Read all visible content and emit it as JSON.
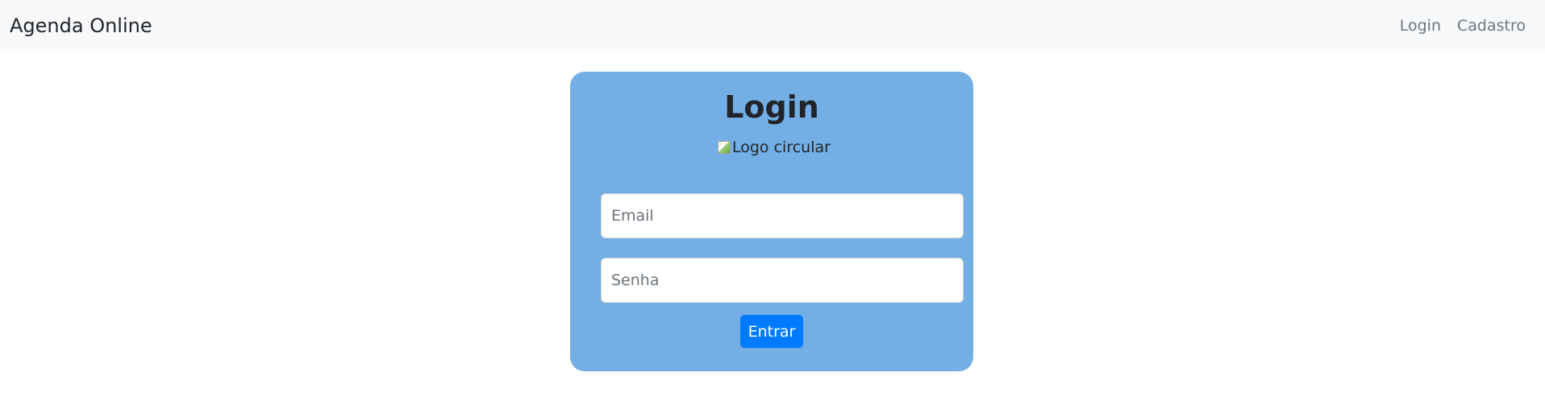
{
  "navbar": {
    "brand": "Agenda Online",
    "links": [
      {
        "label": "Login"
      },
      {
        "label": "Cadastro"
      }
    ]
  },
  "login_card": {
    "title": "Login",
    "logo_alt": "Logo circular",
    "email_placeholder": "Email",
    "password_placeholder": "Senha",
    "submit_label": "Entrar",
    "background_color": "#73afe5",
    "button_color": "#007bff"
  }
}
